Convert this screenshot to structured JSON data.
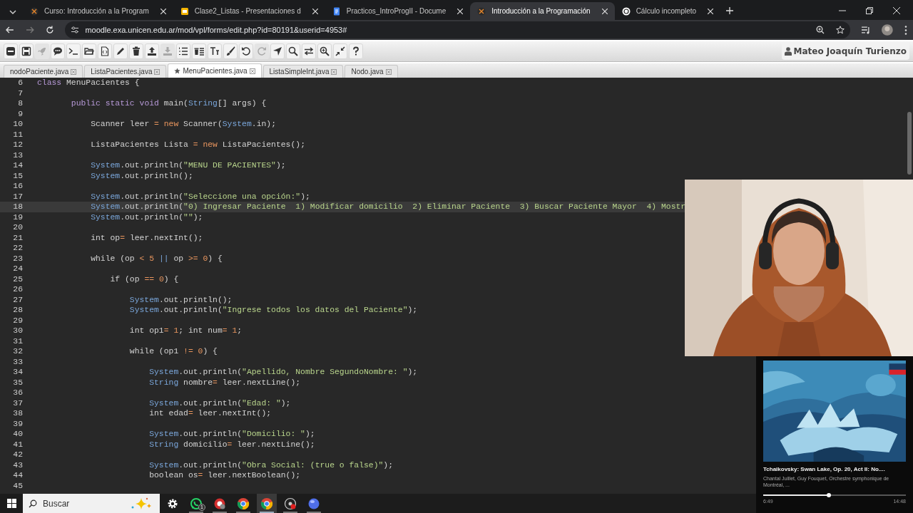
{
  "browser_tabs": [
    {
      "kind": "moodle",
      "title": "Curso: Introducción a la Program",
      "selected": false
    },
    {
      "kind": "slides",
      "title": "Clase2_Listas - Presentaciones d",
      "selected": false
    },
    {
      "kind": "docs",
      "title": "Practicos_IntroProgII - Docume",
      "selected": false
    },
    {
      "kind": "moodle",
      "title": "Introducción a la Programación",
      "selected": true
    },
    {
      "kind": "chat",
      "title": "Cálculo incompleto",
      "selected": false
    }
  ],
  "address_bar": {
    "url": "moodle.exa.unicen.edu.ar/mod/vpl/forms/edit.php?id=80191&userid=4953#"
  },
  "toolbar": {
    "buttons": [
      {
        "kind": "collapse",
        "disabled": false
      },
      {
        "kind": "save",
        "disabled": false
      },
      {
        "kind": "run",
        "disabled": true
      },
      {
        "kind": "comment",
        "disabled": false
      },
      {
        "kind": "console",
        "disabled": false
      },
      {
        "kind": "open",
        "disabled": false
      },
      {
        "kind": "file",
        "disabled": false
      },
      {
        "kind": "edit",
        "disabled": false
      },
      {
        "kind": "delete",
        "disabled": false
      },
      {
        "kind": "upload",
        "disabled": false
      },
      {
        "kind": "download",
        "disabled": true
      },
      {
        "kind": "numbers",
        "disabled": false
      },
      {
        "kind": "delete-list",
        "disabled": false
      },
      {
        "kind": "font",
        "disabled": false
      },
      {
        "kind": "theme",
        "disabled": false
      },
      {
        "kind": "undo",
        "disabled": false
      },
      {
        "kind": "redo",
        "disabled": true
      },
      {
        "kind": "goto",
        "disabled": false
      },
      {
        "kind": "search",
        "disabled": false
      },
      {
        "kind": "replace",
        "disabled": false
      },
      {
        "kind": "zoom",
        "disabled": false
      },
      {
        "kind": "fullscreen",
        "disabled": false
      },
      {
        "kind": "help",
        "disabled": false
      }
    ],
    "user": "Mateo Joaquín Turienzo"
  },
  "file_tabs": [
    {
      "name": "nodoPaciente.java",
      "selected": false,
      "modified": false
    },
    {
      "name": "ListaPacientes.java",
      "selected": false,
      "modified": false
    },
    {
      "name": "MenuPacientes.java",
      "selected": true,
      "modified": true
    },
    {
      "name": "ListaSimpleInt.java",
      "selected": false,
      "modified": false
    },
    {
      "name": "Nodo.java",
      "selected": false,
      "modified": false
    }
  ],
  "editor": {
    "lines": [
      {
        "number": "6",
        "active": false,
        "tokens": [
          {
            "kind": "k",
            "text": "class"
          },
          {
            "kind": "p",
            "text": " MenuPacientes {"
          }
        ]
      },
      {
        "number": "7",
        "active": false
      },
      {
        "number": "8",
        "active": false,
        "tokens": [
          {
            "kind": "k",
            "text": "       public static void"
          },
          {
            "kind": "p",
            "text": " main("
          },
          {
            "kind": "t",
            "text": "String"
          },
          {
            "kind": "p",
            "text": "[] args) {"
          }
        ]
      },
      {
        "number": "9",
        "active": false
      },
      {
        "number": "10",
        "active": false,
        "tokens": [
          {
            "kind": "p",
            "text": "           Scanner leer "
          },
          {
            "kind": "o",
            "text": "="
          },
          {
            "kind": "o",
            "text": " new"
          },
          {
            "kind": "p",
            "text": " Scanner("
          },
          {
            "kind": "t",
            "text": "System"
          },
          {
            "kind": "p",
            "text": ".in);"
          }
        ]
      },
      {
        "number": "11",
        "active": false
      },
      {
        "number": "12",
        "active": false,
        "tokens": [
          {
            "kind": "p",
            "text": "           ListaPacientes Lista "
          },
          {
            "kind": "o",
            "text": "="
          },
          {
            "kind": "o",
            "text": " new"
          },
          {
            "kind": "p",
            "text": " ListaPacientes();"
          }
        ]
      },
      {
        "number": "13",
        "active": false
      },
      {
        "number": "14",
        "active": false,
        "tokens": [
          {
            "kind": "t",
            "text": "           System"
          },
          {
            "kind": "p",
            "text": ".out.println("
          },
          {
            "kind": "s",
            "text": "\"MENU DE PACIENTES\""
          },
          {
            "kind": "p",
            "text": ");"
          }
        ]
      },
      {
        "number": "15",
        "active": false,
        "tokens": [
          {
            "kind": "t",
            "text": "           System"
          },
          {
            "kind": "p",
            "text": ".out.println();"
          }
        ]
      },
      {
        "number": "16",
        "active": false
      },
      {
        "number": "17",
        "active": false,
        "tokens": [
          {
            "kind": "t",
            "text": "           System"
          },
          {
            "kind": "p",
            "text": ".out.println("
          },
          {
            "kind": "s",
            "text": "\"Seleccione una opción:\""
          },
          {
            "kind": "p",
            "text": ");"
          }
        ]
      },
      {
        "number": "18",
        "active": true,
        "tokens": [
          {
            "kind": "t",
            "text": "           System"
          },
          {
            "kind": "p",
            "text": ".out.println("
          },
          {
            "kind": "s",
            "text": "\"0) Ingresar Paciente  1) Modificar domicilio  2) Eliminar Paciente  3) Buscar Paciente Mayor  4) Mostr"
          }
        ]
      },
      {
        "number": "19",
        "active": false,
        "tokens": [
          {
            "kind": "t",
            "text": "           System"
          },
          {
            "kind": "p",
            "text": ".out.println("
          },
          {
            "kind": "s",
            "text": "\"\""
          },
          {
            "kind": "p",
            "text": ");"
          }
        ]
      },
      {
        "number": "20",
        "active": false
      },
      {
        "number": "21",
        "active": false,
        "tokens": [
          {
            "kind": "p",
            "text": "           int op"
          },
          {
            "kind": "o",
            "text": "="
          },
          {
            "kind": "p",
            "text": " leer.nextInt();"
          }
        ]
      },
      {
        "number": "22",
        "active": false
      },
      {
        "number": "23",
        "active": false,
        "tokens": [
          {
            "kind": "p",
            "text": "           while (op "
          },
          {
            "kind": "o",
            "text": "<"
          },
          {
            "kind": "n",
            "text": " 5"
          },
          {
            "kind": "t",
            "text": " ||"
          },
          {
            "kind": "p",
            "text": " op "
          },
          {
            "kind": "o",
            "text": ">="
          },
          {
            "kind": "n",
            "text": " 0"
          },
          {
            "kind": "p",
            "text": ") {"
          }
        ]
      },
      {
        "number": "24",
        "active": false
      },
      {
        "number": "25",
        "active": false,
        "tokens": [
          {
            "kind": "p",
            "text": "               if (op "
          },
          {
            "kind": "o",
            "text": "=="
          },
          {
            "kind": "n",
            "text": " 0"
          },
          {
            "kind": "p",
            "text": ") {"
          }
        ]
      },
      {
        "number": "26",
        "active": false
      },
      {
        "number": "27",
        "active": false,
        "tokens": [
          {
            "kind": "t",
            "text": "                   System"
          },
          {
            "kind": "p",
            "text": ".out.println();"
          }
        ]
      },
      {
        "number": "28",
        "active": false,
        "tokens": [
          {
            "kind": "t",
            "text": "                   System"
          },
          {
            "kind": "p",
            "text": ".out.println("
          },
          {
            "kind": "s",
            "text": "\"Ingrese todos los datos del Paciente\""
          },
          {
            "kind": "p",
            "text": ");"
          }
        ]
      },
      {
        "number": "29",
        "active": false
      },
      {
        "number": "30",
        "active": false,
        "tokens": [
          {
            "kind": "p",
            "text": "                   int op1"
          },
          {
            "kind": "o",
            "text": "="
          },
          {
            "kind": "n",
            "text": " 1"
          },
          {
            "kind": "p",
            "text": "; int num"
          },
          {
            "kind": "o",
            "text": "="
          },
          {
            "kind": "n",
            "text": " 1"
          },
          {
            "kind": "p",
            "text": ";"
          }
        ]
      },
      {
        "number": "31",
        "active": false
      },
      {
        "number": "32",
        "active": false,
        "tokens": [
          {
            "kind": "p",
            "text": "                   while (op1 "
          },
          {
            "kind": "o",
            "text": "!="
          },
          {
            "kind": "n",
            "text": " 0"
          },
          {
            "kind": "p",
            "text": ") {"
          }
        ]
      },
      {
        "number": "33",
        "active": false
      },
      {
        "number": "34",
        "active": false,
        "tokens": [
          {
            "kind": "t",
            "text": "                       System"
          },
          {
            "kind": "p",
            "text": ".out.println("
          },
          {
            "kind": "s",
            "text": "\"Apellido, Nombre SegundoNombre: \""
          },
          {
            "kind": "p",
            "text": ");"
          }
        ]
      },
      {
        "number": "35",
        "active": false,
        "tokens": [
          {
            "kind": "t",
            "text": "                       String"
          },
          {
            "kind": "p",
            "text": " nombre"
          },
          {
            "kind": "o",
            "text": "="
          },
          {
            "kind": "p",
            "text": " leer.nextLine();"
          }
        ]
      },
      {
        "number": "36",
        "active": false
      },
      {
        "number": "37",
        "active": false,
        "tokens": [
          {
            "kind": "t",
            "text": "                       System"
          },
          {
            "kind": "p",
            "text": ".out.println("
          },
          {
            "kind": "s",
            "text": "\"Edad: \""
          },
          {
            "kind": "p",
            "text": ");"
          }
        ]
      },
      {
        "number": "38",
        "active": false,
        "tokens": [
          {
            "kind": "p",
            "text": "                       int edad"
          },
          {
            "kind": "o",
            "text": "="
          },
          {
            "kind": "p",
            "text": " leer.nextInt();"
          }
        ]
      },
      {
        "number": "39",
        "active": false
      },
      {
        "number": "40",
        "active": false,
        "tokens": [
          {
            "kind": "t",
            "text": "                       System"
          },
          {
            "kind": "p",
            "text": ".out.println("
          },
          {
            "kind": "s",
            "text": "\"Domicilio: \""
          },
          {
            "kind": "p",
            "text": ");"
          }
        ]
      },
      {
        "number": "41",
        "active": false,
        "tokens": [
          {
            "kind": "t",
            "text": "                       String"
          },
          {
            "kind": "p",
            "text": " domicilio"
          },
          {
            "kind": "o",
            "text": "="
          },
          {
            "kind": "p",
            "text": " leer.nextLine();"
          }
        ]
      },
      {
        "number": "42",
        "active": false
      },
      {
        "number": "43",
        "active": false,
        "tokens": [
          {
            "kind": "t",
            "text": "                       System"
          },
          {
            "kind": "p",
            "text": ".out.println("
          },
          {
            "kind": "s",
            "text": "\"Obra Social: (true o false)\""
          },
          {
            "kind": "p",
            "text": ");"
          }
        ]
      },
      {
        "number": "44",
        "active": false,
        "tokens": [
          {
            "kind": "p",
            "text": "                       boolean os"
          },
          {
            "kind": "o",
            "text": "="
          },
          {
            "kind": "p",
            "text": " leer.nextBoolean();"
          }
        ]
      },
      {
        "number": "45",
        "active": false
      }
    ]
  },
  "media_player": {
    "title": "Tchaikovsky: Swan Lake, Op. 20, Act II: No....",
    "artists": "Chantal Juillet, Guy Fouquet, Orchestre symphonique de Montréal, ...",
    "level": 0.46,
    "elapsed": "6:49",
    "duration": "14:48"
  },
  "taskbar": {
    "search": {
      "placeholder": "Buscar"
    },
    "apps": [
      {
        "kind": "settings",
        "running": false,
        "selected": false
      },
      {
        "kind": "whatsapp",
        "badge": "1",
        "running": true,
        "selected": false
      },
      {
        "kind": "red-app",
        "running": true,
        "selected": false
      },
      {
        "kind": "chrome",
        "running": true,
        "selected": false
      },
      {
        "kind": "chrome",
        "running": true,
        "selected": true
      },
      {
        "kind": "recorder",
        "running": true,
        "selected": false
      },
      {
        "kind": "blue-app",
        "running": true,
        "selected": false
      }
    ]
  }
}
